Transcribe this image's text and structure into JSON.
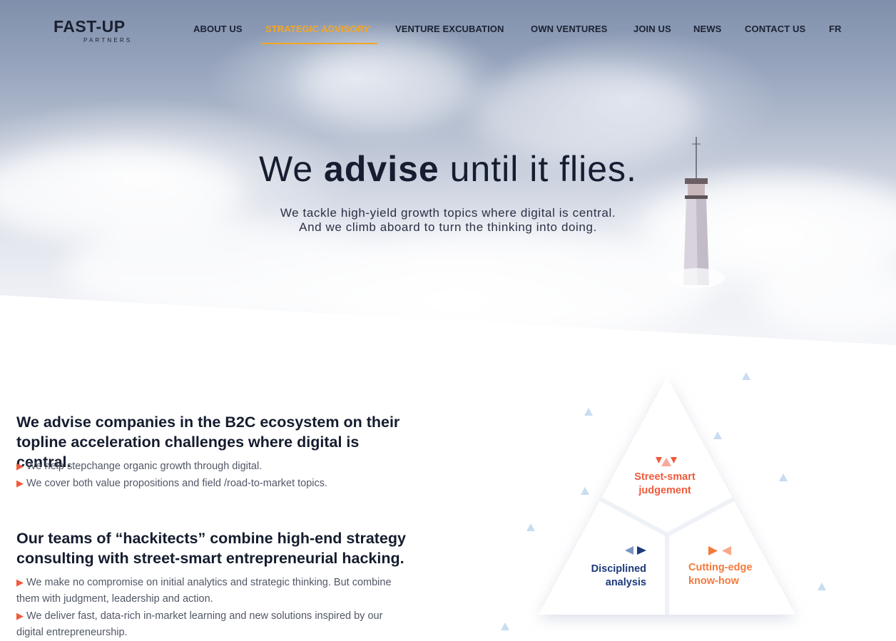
{
  "brand": {
    "name": "FAST-UP",
    "tagline": "PARTNERS"
  },
  "nav": {
    "items": [
      {
        "label": "ABOUT US"
      },
      {
        "label": "STRATEGIC ADVISORY",
        "active": true
      },
      {
        "label": "VENTURE EXCUBATION"
      },
      {
        "label": "OWN VENTURES"
      },
      {
        "label": "JOIN US"
      },
      {
        "label": "NEWS"
      },
      {
        "label": "CONTACT US"
      },
      {
        "label": "FR"
      }
    ]
  },
  "hero": {
    "title_pre": "We ",
    "title_bold": "advise",
    "title_post": " until it flies.",
    "subtitle_line1": "We tackle high-yield growth topics where digital is central.",
    "subtitle_line2": "And we climb aboard to turn the thinking into doing."
  },
  "sections": [
    {
      "heading_line1": "We advise companies in the B2C ecosystem on their",
      "heading_line2": "topline acceleration challenges where digital is central.",
      "bullets": [
        "We help stepchange organic growth through digital.",
        "We cover both value propositions and field /road-to-market topics."
      ]
    },
    {
      "heading_line1": "Our teams of “hackitects” combine high-end strategy",
      "heading_line2": "consulting with street-smart entrepreneurial hacking.",
      "bullets": [
        "We make no compromise on initial analytics and strategic thinking. But combine them with judgment, leadership and action.",
        "We deliver fast, data-rich in-market learning and new solutions inspired by our digital entrepreneurship."
      ]
    }
  ],
  "diagram": {
    "top_line1": "Street-smart",
    "top_line2": "judgement",
    "left_line1": "Disciplined",
    "left_line2": "analysis",
    "right_line1": "Cutting-edge",
    "right_line2": "know-how"
  },
  "colors": {
    "accent": "#f5a623",
    "red": "#f05a3c",
    "navy": "#1d3a7a",
    "orange": "#f47a3c",
    "light_blue": "#c9dcf2"
  }
}
